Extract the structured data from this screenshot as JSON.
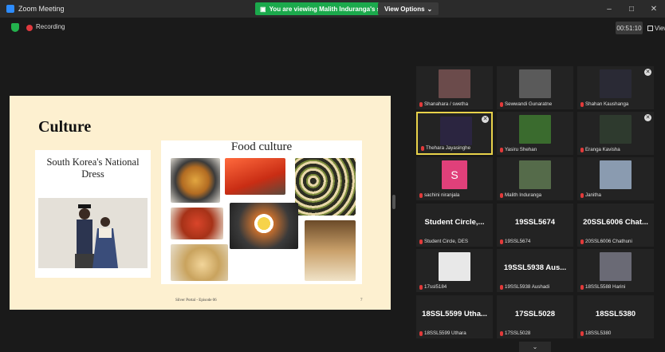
{
  "window": {
    "title": "Zoom Meeting",
    "controls": [
      "minimize",
      "maximize",
      "close"
    ]
  },
  "banner": {
    "sharing_text": "You are viewing Malith Induranga's screen",
    "view_options": "View Options"
  },
  "status": {
    "recording": "Recording",
    "timer": "00:51:10",
    "view": "View"
  },
  "slide": {
    "title": "Culture",
    "dress_title": "South Korea's National Dress",
    "food_title": "Food culture",
    "footer": "Silver Portal - Episode 06",
    "page_number": "7"
  },
  "participants": [
    {
      "name": "Shanahara / swetha",
      "type": "video",
      "color": "#6b4b4b"
    },
    {
      "name": "Sewwandi Gunaratne",
      "type": "video",
      "color": "#5a5a5a"
    },
    {
      "name": "Shahan Kaushanga",
      "type": "video",
      "color": "#2a2a35"
    },
    {
      "name": "Thehara Jayasinghe",
      "type": "video",
      "color": "#2b2540",
      "active": true
    },
    {
      "name": "Yasiru Shehan",
      "type": "video",
      "color": "#3a6b2e"
    },
    {
      "name": "Eranga Kavisha",
      "type": "video",
      "color": "#2e3a2e"
    },
    {
      "name": "sachini niranjala",
      "type": "initial",
      "initial": "S",
      "color": "#e0407a"
    },
    {
      "name": "Malith Induranga",
      "type": "video",
      "color": "#556b4a"
    },
    {
      "name": "Janitha",
      "type": "video",
      "color": "#8a9bb0"
    },
    {
      "name": "Student Circle, DES",
      "type": "text",
      "label": "Student Circle,..."
    },
    {
      "name": "19SSL5674",
      "type": "text",
      "label": "19SSL5674"
    },
    {
      "name": "20SSL6006 Chathuni",
      "type": "text",
      "label": "20SSL6006 Chat..."
    },
    {
      "name": "17ssl5184",
      "type": "video",
      "color": "#e8e8e8"
    },
    {
      "name": "19SSL5938 Aushadi",
      "type": "text",
      "label": "19SSL5938 Aus..."
    },
    {
      "name": "18SSL5588 Harini",
      "type": "video",
      "color": "#6a6a75"
    },
    {
      "name": "18SSL5599 Uthara",
      "type": "text",
      "label": "18SSL5599 Utha..."
    },
    {
      "name": "17SSL5028",
      "type": "text",
      "label": "17SSL5028"
    },
    {
      "name": "18SSL5380",
      "type": "text",
      "label": "18SSL5380"
    }
  ]
}
